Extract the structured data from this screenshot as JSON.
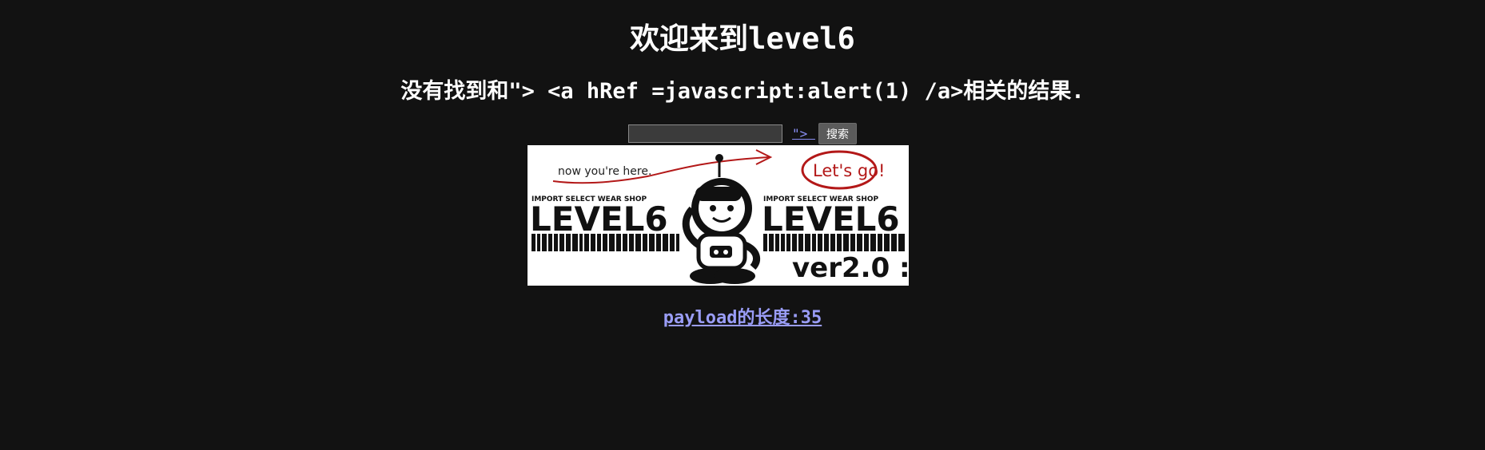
{
  "page": {
    "title": "欢迎来到level6",
    "result_text": "没有找到和\"> <a hRef =javascript:alert(1) /a>相关的结果.",
    "search": {
      "value": "",
      "placeholder": ""
    },
    "injected_link_text": "\"> ",
    "search_button_label": "搜索",
    "banner": {
      "note_text": "now you're here.",
      "bubble_text": "Let's go!",
      "shop_text": "IMPORT SELECT WEAR SHOP",
      "level_text": "LEVEL6",
      "version_text": "ver2.0 :"
    },
    "payload_label": "payload的长度:35"
  },
  "colors": {
    "background": "#121212",
    "text": "#ffffff",
    "link": "#9a9df7",
    "button": "#5b5b5b",
    "banner_red": "#b31818"
  }
}
